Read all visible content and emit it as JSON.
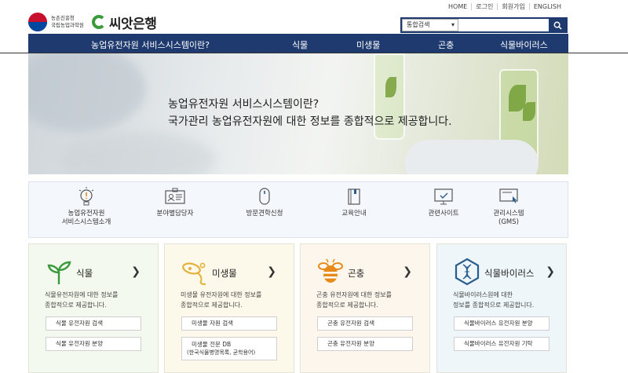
{
  "util_links": [
    "HOME",
    "로그인",
    "회원가입",
    "ENGLISH"
  ],
  "header": {
    "org_line1": "농촌진흥청",
    "org_line2": "국립농업과학원",
    "brand": "씨앗은행"
  },
  "search": {
    "category": "통합검색",
    "placeholder": ""
  },
  "nav": [
    "농업유전자원 서비스시스템이란?",
    "식물",
    "미생물",
    "곤충",
    "식물바이러스"
  ],
  "hero": {
    "line1": "농업유전자원 서비스시스템이란?",
    "line2": "국가관리 농업유전자원에 대한 정보를 종합적으로 제공합니다."
  },
  "quick_menu": [
    {
      "line1": "농업유전자원",
      "line2": "서비스시스템소개",
      "icon": "lightbulb-icon"
    },
    {
      "line1": "분야별담당자",
      "line2": "",
      "icon": "id-card-icon"
    },
    {
      "line1": "방문견학신청",
      "line2": "",
      "icon": "mouse-icon"
    },
    {
      "line1": "교육안내",
      "line2": "",
      "icon": "book-icon"
    },
    {
      "line1": "관련사이트",
      "line2": "",
      "icon": "monitor-icon"
    },
    {
      "line1": "관리시스템",
      "line2": "(GMS)",
      "icon": "screen-cursor-icon"
    }
  ],
  "cards": [
    {
      "title": "식물",
      "desc1": "식물유전자원에 대한 정보를",
      "desc2": "종합적으로 제공합니다.",
      "btn1": "식물 유전자원 검색",
      "btn2": "식물 유전자원 분양",
      "btn2b": "",
      "bg": "#f3f9ee",
      "icon": "sprout-icon"
    },
    {
      "title": "미생물",
      "desc1": "미생물 유전자원에 대한 정보를",
      "desc2": "종합적으로 제공합니다.",
      "btn1": "미생물 자원 검색",
      "btn2": "미생물 전문 DB",
      "btn2b": "(한국식물병명목록, 균학용어)",
      "bg": "#fdf9ea",
      "icon": "microbe-icon"
    },
    {
      "title": "곤충",
      "desc1": "곤충 유전자원에 대한 정보를",
      "desc2": "종합적으로 제공합니다.",
      "btn1": "곤충 유전자원 검색",
      "btn2": "곤충 유전자원 분양",
      "btn2b": "",
      "bg": "#fcf6ec",
      "icon": "bee-icon"
    },
    {
      "title": "식물바이러스",
      "desc1": "식물바이러스원에 대한",
      "desc2": "정보를 종합적으로 제공합니다.",
      "btn1": "식물바이러스 유전자원 분양",
      "btn2": "식물바이러스 유전자원 기탁",
      "btn2b": "",
      "bg": "#eef6f9",
      "icon": "dna-hexagon-icon"
    }
  ],
  "colors": {
    "navy": "#1e3a6e",
    "plant_green": "#3b9b3a",
    "microbe_yellow": "#e2b23a",
    "insect_orange": "#e88a1a",
    "virus_blue": "#2a5d8f"
  }
}
